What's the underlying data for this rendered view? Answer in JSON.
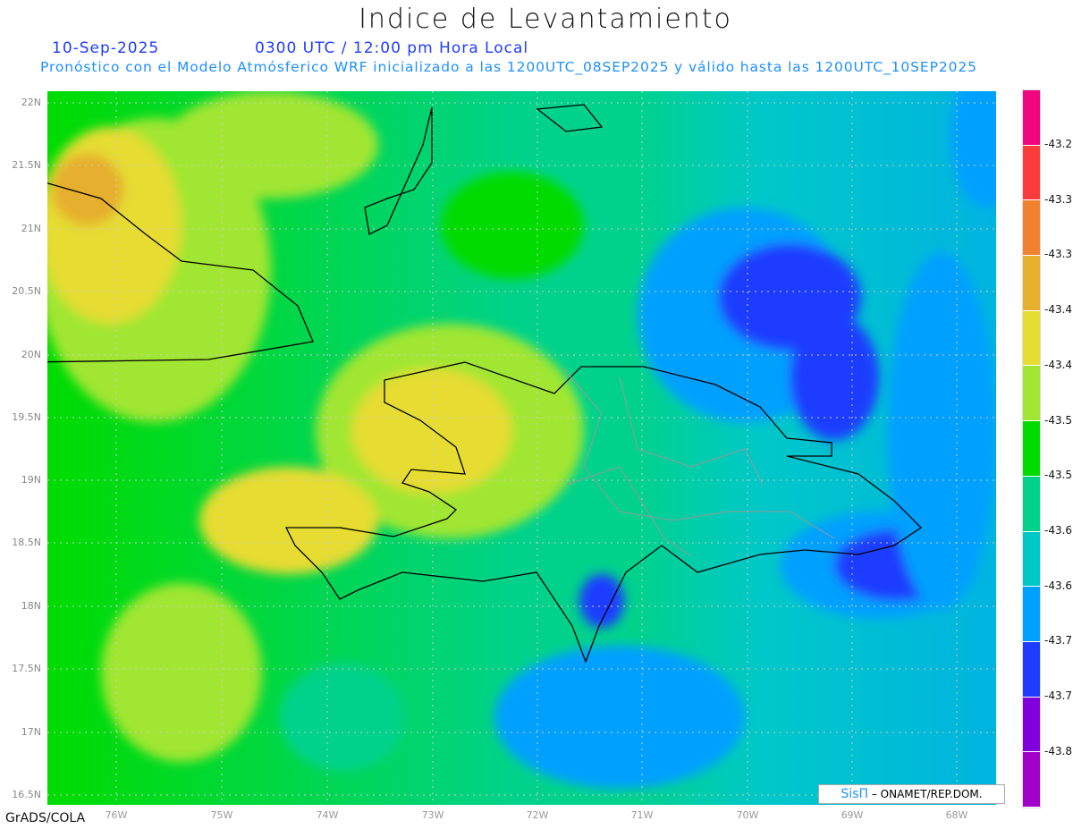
{
  "title": "Indice de Levantamiento",
  "date": "10-Sep-2025",
  "time": "0300 UTC / 12:00 pm Hora Local",
  "subtitle": "Pronóstico con el Modelo Atmósferico WRF inicializado a las 1200UTC_08SEP2025 y válido hasta las  1200UTC_10SEP2025",
  "lat_labels": [
    "22N",
    "21.5N",
    "21N",
    "20.5N",
    "20N",
    "19.5N",
    "19N",
    "18.5N",
    "18N",
    "17.5N",
    "17N",
    "16.5N"
  ],
  "lon_labels": [
    "76W",
    "75W",
    "74W",
    "73W",
    "72W",
    "71W",
    "70W",
    "69W",
    "68W"
  ],
  "footer": "GrADS/COLA",
  "credit": {
    "logo": "SisΠ",
    "text": " – ONAMET/REP.DOM."
  },
  "colorbar": {
    "colors": [
      "#f0047f",
      "#fc3c3c",
      "#f0822f",
      "#e6af2d",
      "#e6dc32",
      "#a0e632",
      "#00dc00",
      "#00d28c",
      "#00c8c8",
      "#00a0ff",
      "#1e3cff",
      "#8200dc",
      "#a000c8"
    ],
    "labels": [
      "-43.2",
      "-43.3",
      "-43.3",
      "-43.4",
      "-43.4",
      "-43.5",
      "-43.5",
      "-43.6",
      "-43.6",
      "-43.7",
      "-43.7",
      "-43.8"
    ]
  }
}
